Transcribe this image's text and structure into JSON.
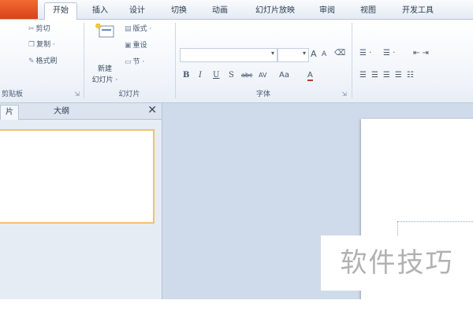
{
  "window": {
    "tabs": [
      {
        "label": "开始",
        "active": true
      },
      {
        "label": "插入"
      },
      {
        "label": "设计"
      },
      {
        "label": "切换"
      },
      {
        "label": "动画"
      },
      {
        "label": "幻灯片放映"
      },
      {
        "label": "审阅"
      },
      {
        "label": "视图"
      },
      {
        "label": "开发工具"
      }
    ]
  },
  "ribbon": {
    "clipboard": {
      "cut": "剪切",
      "copy": "复制 ·",
      "format_painter": "格式刷",
      "label": "剪贴板",
      "launcher": "⇲"
    },
    "slides": {
      "new_slide": "新建",
      "new_slide_line2": "幻灯片 ·",
      "layout": "版式 ·",
      "reset": "重设",
      "section": "节 ·",
      "label": "幻灯片"
    },
    "font": {
      "font_name_value": "",
      "font_size_value": "",
      "grow": "A",
      "shrink": "A",
      "clear": "⌫",
      "bold": "B",
      "italic": "I",
      "underline": "U",
      "strike": "S",
      "abc": "abc",
      "spacing": "AV",
      "case": "Aa",
      "color": "A",
      "label": "字体",
      "launcher": "⇲"
    },
    "paragraph": {
      "bullets": "☰ ·",
      "numbering": "☰ ·",
      "indent": "⇤ ⇥"
    }
  },
  "left_pane": {
    "tabs": [
      {
        "label": "片",
        "active": true
      },
      {
        "label": "大纲"
      }
    ],
    "close": "✕"
  },
  "watermark": {
    "text": "软件技巧"
  },
  "colors": {
    "file_tab": "#e2532a",
    "selected_thumb_border": "#f1c36b",
    "editor_bg": "#cfdbea"
  }
}
